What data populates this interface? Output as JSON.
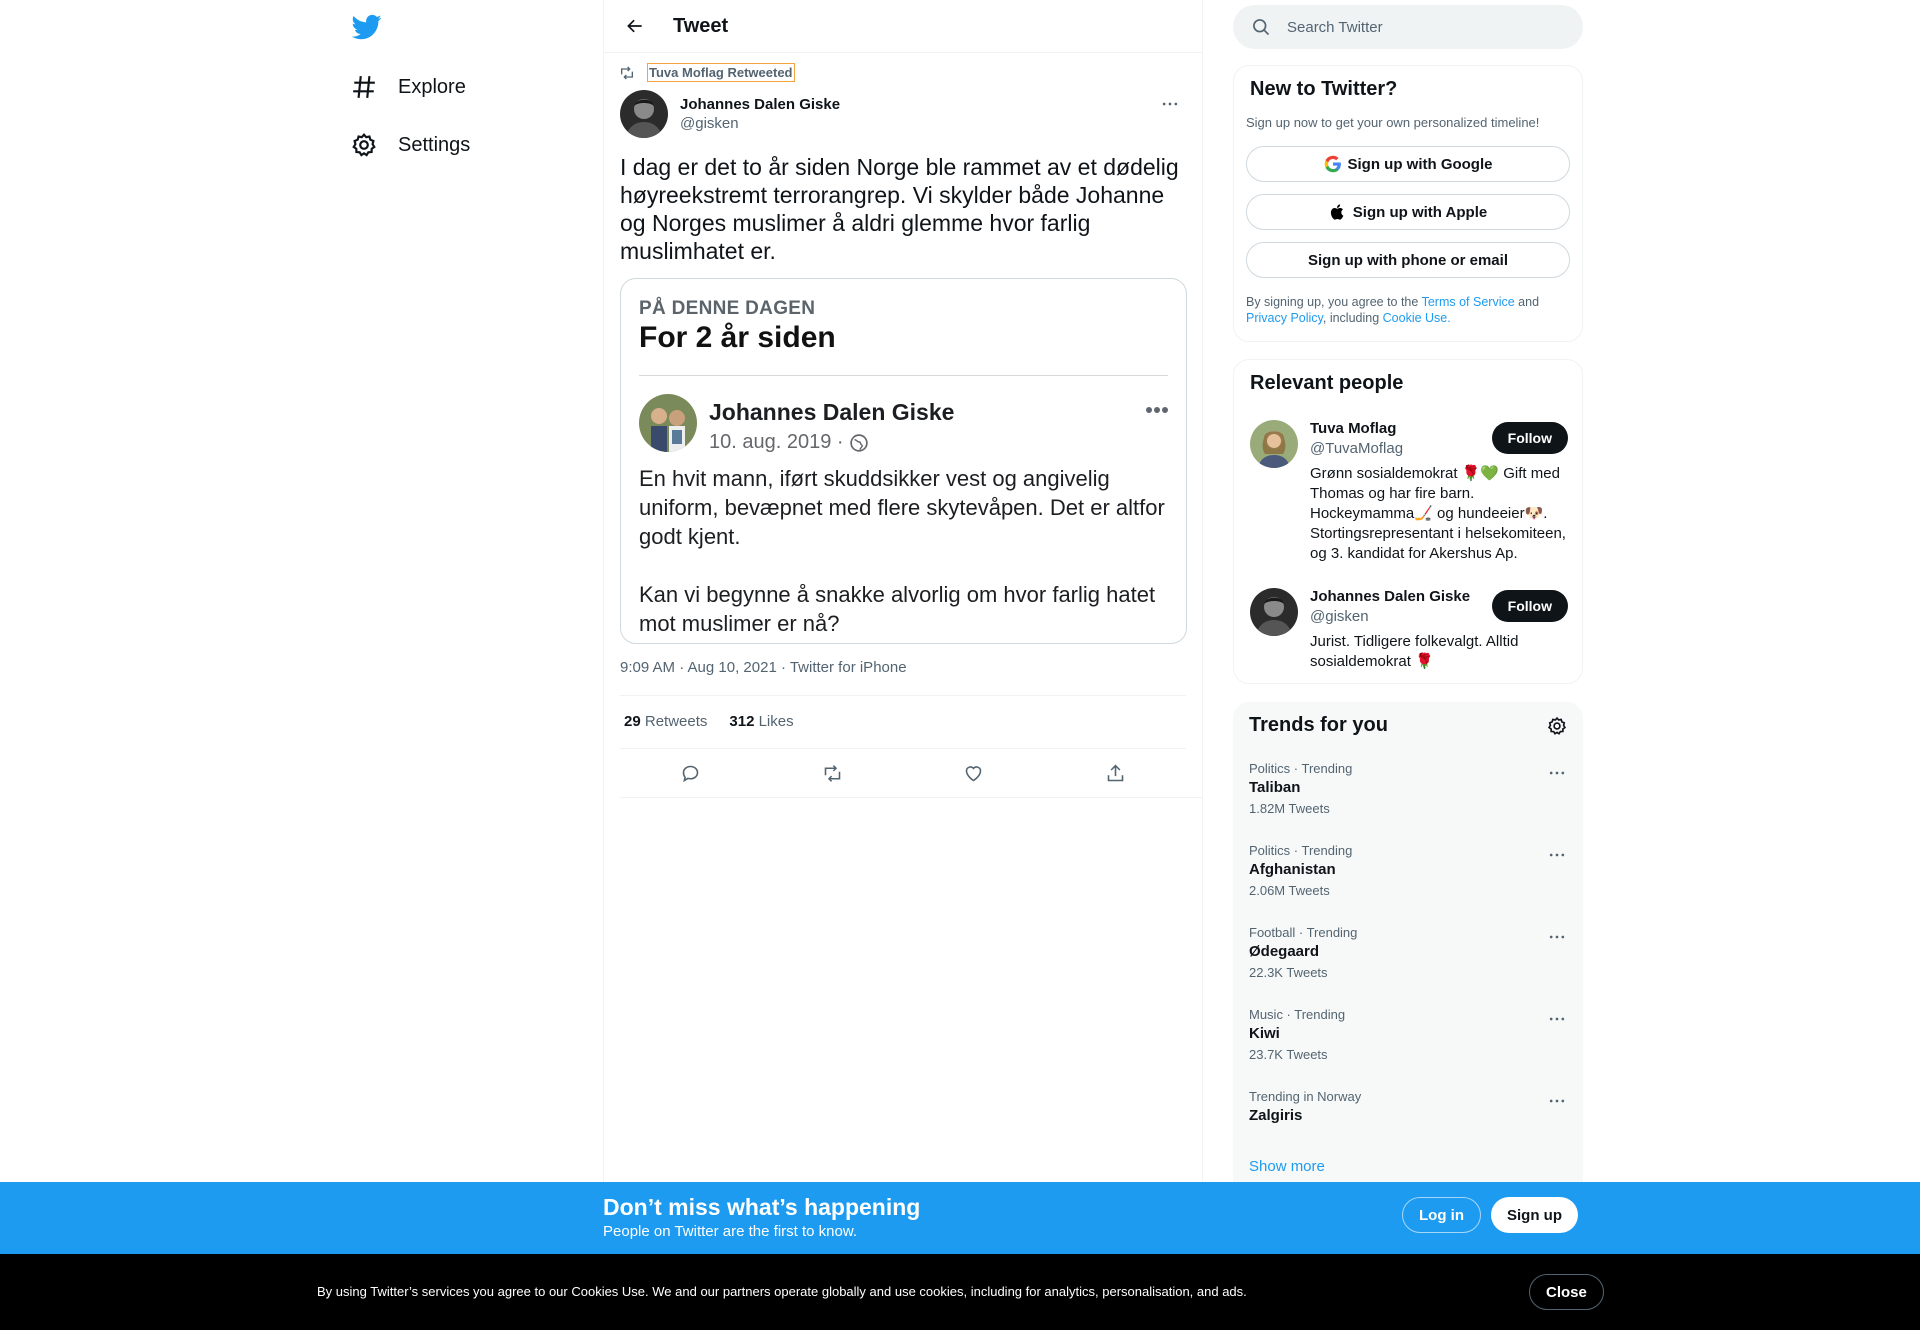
{
  "nav": {
    "items": [
      {
        "label": "Explore",
        "icon": "hashtag-icon"
      },
      {
        "label": "Settings",
        "icon": "gear-icon"
      }
    ]
  },
  "header": {
    "title": "Tweet"
  },
  "tweet": {
    "retweet_context": "Tuva Moflag Retweeted",
    "author_name": "Johannes Dalen Giske",
    "author_handle": "@gisken",
    "text": "I dag er det to år siden Norge ble rammet av et dødelig høyreekstremt terrorangrep. Vi skylder både Johanne og Norges muslimer å aldri glemme hvor farlig muslimhatet er.",
    "media": {
      "overline": "PÅ DENNE DAGEN",
      "title": "For 2 år siden",
      "name": "Johannes Dalen Giske",
      "date": "10. aug. 2019 ·",
      "body_1": "En hvit mann, iført skuddsikker vest og angivelig uniform, bevæpnet med flere skytevåpen. Det er altfor godt kjent.",
      "body_2": "Kan vi begynne å snakke alvorlig om hvor farlig hatet mot muslimer er nå?"
    },
    "meta": "9:09 AM · Aug 10, 2021 · Twitter for iPhone",
    "retweets_count": "29",
    "retweets_label": "Retweets",
    "likes_count": "312",
    "likes_label": "Likes"
  },
  "search": {
    "placeholder": "Search Twitter"
  },
  "new_to_twitter": {
    "title": "New to Twitter?",
    "subtitle": "Sign up now to get your own personalized timeline!",
    "google_label": "Sign up with Google",
    "apple_label": "Sign up with Apple",
    "phone_label": "Sign up with phone or email",
    "legal_1": "By signing up, you agree to the ",
    "terms": "Terms of Service",
    "legal_2": " and ",
    "privacy": "Privacy Policy",
    "legal_3": ", including ",
    "cookie": "Cookie Use."
  },
  "relevant_people": {
    "title": "Relevant people",
    "people": [
      {
        "name": "Tuva Moflag",
        "handle": "@TuvaMoflag",
        "bio": "Grønn sosialdemokrat 🌹💚 Gift med Thomas og har fire barn. Hockeymamma🏒 og hundeeier🐶. Stortingsrepresentant i helsekomiteen, og 3. kandidat for Akershus Ap.",
        "follow_label": "Follow"
      },
      {
        "name": "Johannes Dalen Giske",
        "handle": "@gisken",
        "bio": "Jurist. Tidligere folkevalgt. Alltid sosialdemokrat 🌹",
        "follow_label": "Follow"
      }
    ]
  },
  "trends": {
    "title": "Trends for you",
    "items": [
      {
        "context": "Politics · Trending",
        "name": "Taliban",
        "count": "1.82M Tweets"
      },
      {
        "context": "Politics · Trending",
        "name": "Afghanistan",
        "count": "2.06M Tweets"
      },
      {
        "context": "Football · Trending",
        "name": "Ødegaard",
        "count": "22.3K Tweets"
      },
      {
        "context": "Music · Trending",
        "name": "Kiwi",
        "count": "23.7K Tweets"
      },
      {
        "context": "Trending in Norway",
        "name": "Zalgiris",
        "count": ""
      }
    ],
    "show_more": "Show more"
  },
  "bottom_bar": {
    "title": "Don’t miss what’s happening",
    "subtitle": "People on Twitter are the first to know.",
    "login_label": "Log in",
    "signup_label": "Sign up"
  },
  "cookie_bar": {
    "text": "By using Twitter’s services you agree to our Cookies Use. We and our partners operate globally and use cookies, including for analytics, personalisation, and ads.",
    "close_label": "Close"
  },
  "colors": {
    "brand": "#1d9bf0",
    "text": "#0f1419",
    "secondary": "#536471"
  }
}
